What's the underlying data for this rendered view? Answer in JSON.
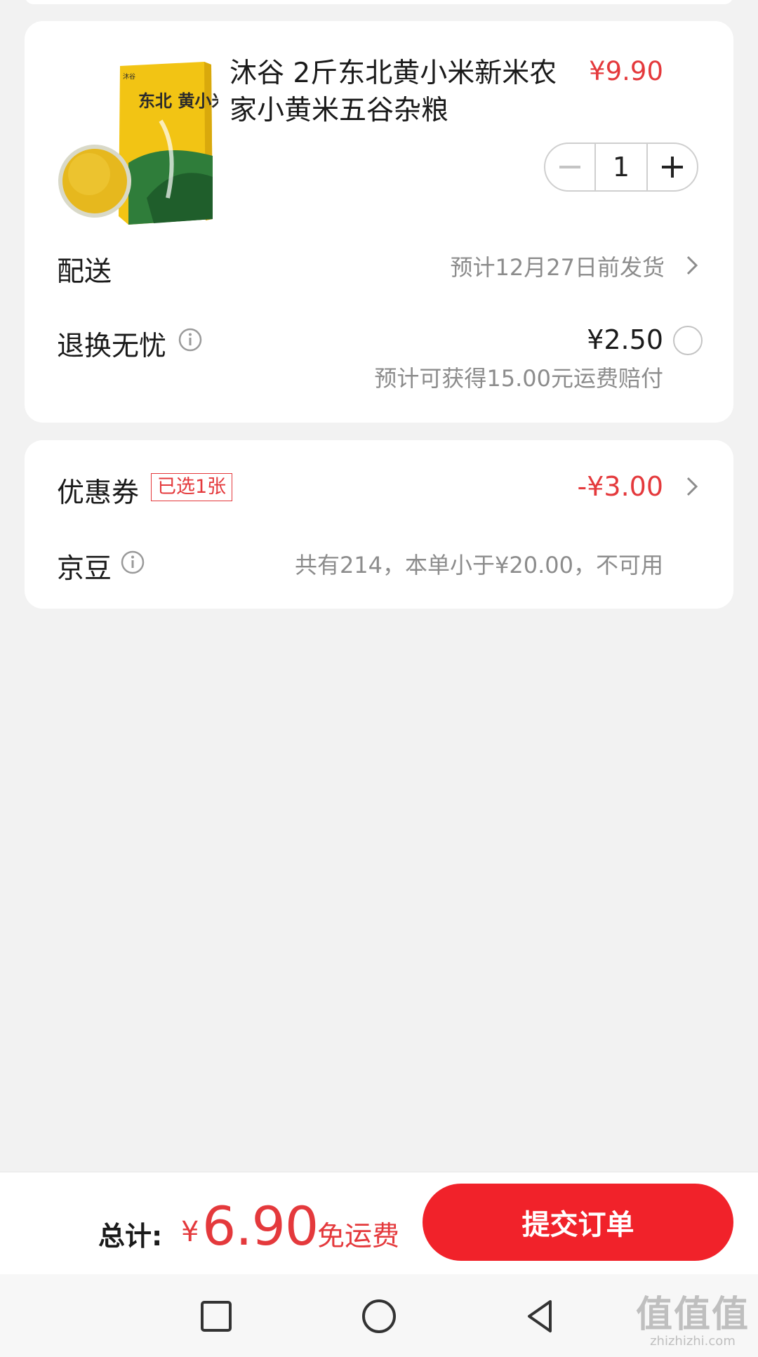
{
  "product": {
    "title": "沐谷 2斤东北黄小米新米农家小黄米五谷杂粮",
    "price": "¥9.90",
    "quantity": "1",
    "package_text": "东北 黄小米",
    "brand_mark": "沐谷",
    "colors": {
      "bag": "#f2c414",
      "millet": "#e6b81e",
      "bag_green": "#2f7d3a"
    }
  },
  "shipping": {
    "label": "配送",
    "value": "预计12月27日前发货"
  },
  "return_service": {
    "label": "退换无忧",
    "price": "¥2.50",
    "note": "预计可获得15.00元运费赔付"
  },
  "coupon": {
    "label": "优惠券",
    "badge": "已选1张",
    "value": "-¥3.00"
  },
  "jingdou": {
    "label": "京豆",
    "value": "共有214，本单小于¥20.00，不可用"
  },
  "footer": {
    "total_label": "总计:",
    "currency": "¥",
    "total_amount": "6.90",
    "free_shipping": "免运费",
    "submit_label": "提交订单"
  },
  "navbar": {
    "icons": [
      "square-icon",
      "circle-icon",
      "triangle-back-icon"
    ]
  },
  "watermark": {
    "main": "值值值",
    "sub": "zhizhizhi.com"
  },
  "theme": {
    "accent": "#e4393c",
    "button": "#f1222a",
    "background": "#f2f2f2"
  }
}
